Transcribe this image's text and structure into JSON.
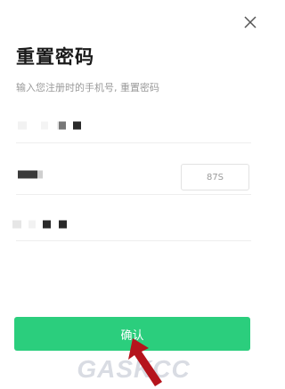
{
  "page": {
    "title": "重置密码",
    "subtitle": "输入您注册时的手机号, 重置密码"
  },
  "form": {
    "verify_code_label": "87S",
    "confirm_label": "确认"
  },
  "watermark": {
    "text": "GASKCC",
    "color": "#d9dce3"
  },
  "colors": {
    "accent": "#2bce7d",
    "arrow": "#b5141c"
  },
  "icons": {
    "close": "close-icon",
    "arrow": "arrow-icon"
  }
}
